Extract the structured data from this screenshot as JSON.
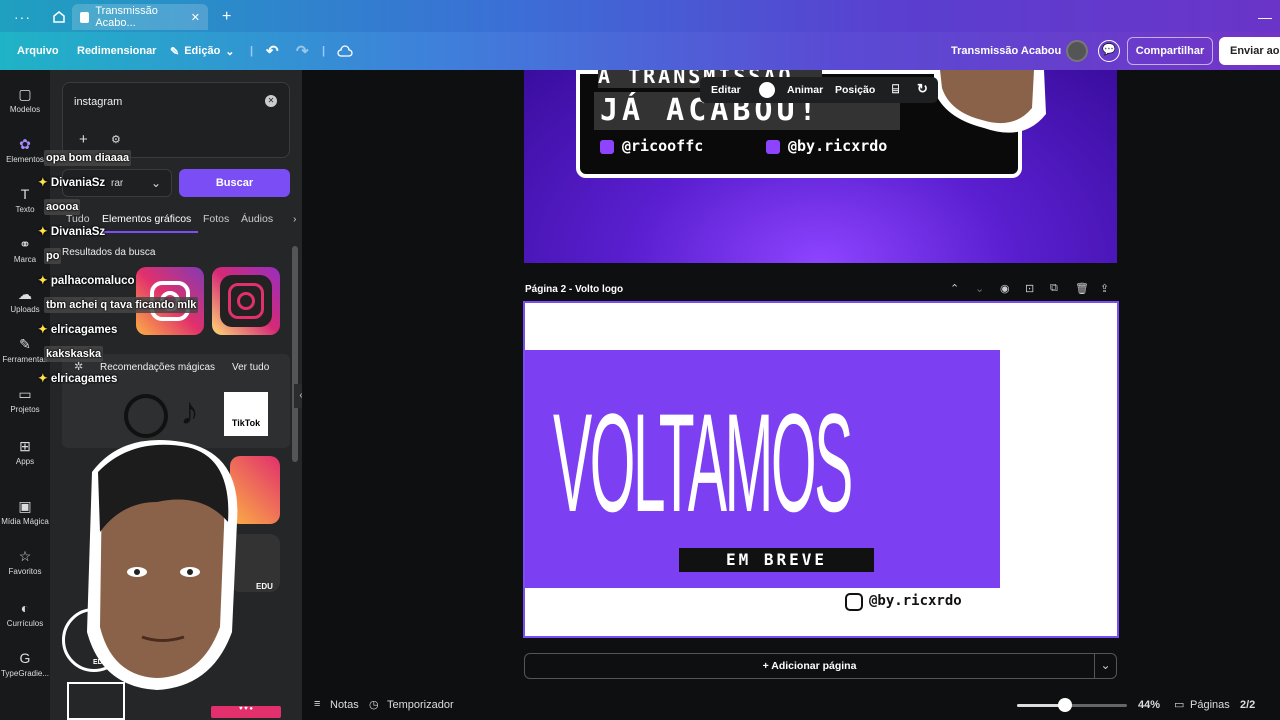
{
  "tabbar": {
    "tab_title": "Transmissão Acabo..."
  },
  "toolbar": {
    "file": "Arquivo",
    "resize": "Redimensionar",
    "edit": "Edição",
    "doc_title": "Transmissão Acabou",
    "share": "Compartilhar",
    "send": "Enviar ao p"
  },
  "rail": [
    {
      "label": "Modelos",
      "icon": "templates-icon"
    },
    {
      "label": "Elementos",
      "icon": "elements-icon"
    },
    {
      "label": "Texto",
      "icon": "text-icon"
    },
    {
      "label": "Marca",
      "icon": "brand-icon"
    },
    {
      "label": "Uploads",
      "icon": "uploads-icon"
    },
    {
      "label": "Ferramentas",
      "icon": "tools-icon"
    },
    {
      "label": "Projetos",
      "icon": "projects-icon"
    },
    {
      "label": "Apps",
      "icon": "apps-icon"
    },
    {
      "label": "Mídia Mágica",
      "icon": "magic-media-icon"
    },
    {
      "label": "Favoritos",
      "icon": "favorites-icon"
    },
    {
      "label": "Currículos",
      "icon": "resumes-icon"
    },
    {
      "label": "TypeGradie...",
      "icon": "typegradient-icon"
    }
  ],
  "panel": {
    "search_value": "instagram",
    "filter_label": "rar",
    "search_button": "Buscar",
    "tabs": [
      "Tudo",
      "Elementos gráficos",
      "Fotos",
      "Áudios"
    ],
    "results_label": "Resultados da busca",
    "magic_label": "Recomendações mágicas",
    "see_all": "Ver tudo",
    "edu": "EDU",
    "tiktok": "TikTok"
  },
  "chat": [
    {
      "user": "",
      "msg": "opa bom diaaaa"
    },
    {
      "user": "DivaniaSz",
      "msg": ""
    },
    {
      "user": "",
      "msg": "aoooa"
    },
    {
      "user": "DivaniaSz",
      "msg": ""
    },
    {
      "user": "",
      "msg": "po"
    },
    {
      "user": "palhacomaluco",
      "msg": ""
    },
    {
      "user": "",
      "msg": "tbm achei q tava ficando mlk"
    },
    {
      "user": "elricagames",
      "msg": ""
    },
    {
      "user": "",
      "msg": "kakskaska"
    },
    {
      "user": "elricagames",
      "msg": ""
    }
  ],
  "page1": {
    "line1": "A TRANSMISSÃO",
    "line2": "JÁ ACABOU!",
    "handle1": "@ricooffc",
    "handle2": "@by.ricxrdo"
  },
  "float_toolbar": {
    "edit": "Editar",
    "animate": "Animar",
    "position": "Posição"
  },
  "page2": {
    "label": "Página 2 - Volto logo",
    "title": "VOLTAMOS",
    "subtitle": "EM BREVE",
    "handle": "@by.ricxrdo"
  },
  "add_page": "+ Adicionar página",
  "bottom": {
    "notes": "Notas",
    "timer": "Temporizador",
    "zoom": "44%",
    "zoom_level": 0.44,
    "pages_label": "Páginas",
    "pages_count": "2/2"
  },
  "colors": {
    "purple": "#7c3ff2",
    "accent": "#7a4df5"
  }
}
